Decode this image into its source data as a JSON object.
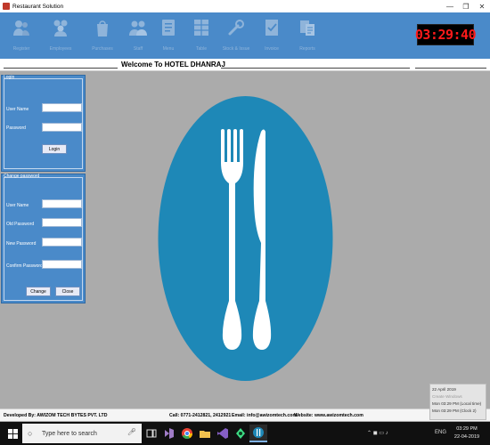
{
  "window": {
    "title": "Restaurant Solution",
    "controls": {
      "minimize": "—",
      "maximize": "❐",
      "close": "✕"
    }
  },
  "toolbar": {
    "items": [
      {
        "label": "Register",
        "icon": "users-icon"
      },
      {
        "label": "Employees",
        "icon": "employees-icon"
      },
      {
        "label": "Purchases",
        "icon": "bag-icon"
      },
      {
        "label": "Staff",
        "icon": "staff-icon"
      },
      {
        "label": "Menu",
        "icon": "menu-icon"
      },
      {
        "label": "Table",
        "icon": "table-icon"
      },
      {
        "label": "Stock & Issue",
        "icon": "tools-icon"
      },
      {
        "label": "Invoice",
        "icon": "invoice-icon"
      },
      {
        "label": "Reports",
        "icon": "reports-icon"
      }
    ],
    "clock": "03:29:40"
  },
  "welcome": {
    "text": "Welcome To HOTEL DHANRAJ"
  },
  "login": {
    "legend": "Login",
    "user_name_label": "User Name",
    "password_label": "Password",
    "user_name_value": "",
    "password_value": "",
    "login_button": "Login"
  },
  "change_password": {
    "legend": "Change password",
    "user_name_label": "User Name",
    "old_password_label": "Old Password",
    "new_password_label": "New Password",
    "confirm_password_label": "Confirm Password",
    "change_button": "Change",
    "close_button": "Close"
  },
  "statusbar": {
    "developed_by": "Developed By: AWIZOM TECH BYTES PVT. LTD",
    "call": "Call: 0771-2412821, 2412921",
    "email": "Email: info@awizomtech.com",
    "website": "Website: www.awizomtech.com"
  },
  "clock_popup": {
    "date": "22 April 2019",
    "watermark": "Create Windows",
    "local": "Mon 03:29 PM  (Local time)",
    "clock2": "Mon 03:29 PM  (Clock 2)"
  },
  "taskbar": {
    "search_placeholder": "Type here to search",
    "lang": "ENG",
    "time": "03:29 PM",
    "date": "22-04-2019",
    "apps": [
      "task-view-icon",
      "visual-studio-icon",
      "chrome-icon",
      "explorer-icon",
      "visual-studio-purple-icon",
      "android-studio-icon",
      "restaurant-app-icon"
    ]
  },
  "colors": {
    "toolbar_blue": "#4a8ac9",
    "logo_blue": "#1e88b7",
    "clock_red": "#ff1a1a",
    "desktop_gray": "#ababab"
  }
}
